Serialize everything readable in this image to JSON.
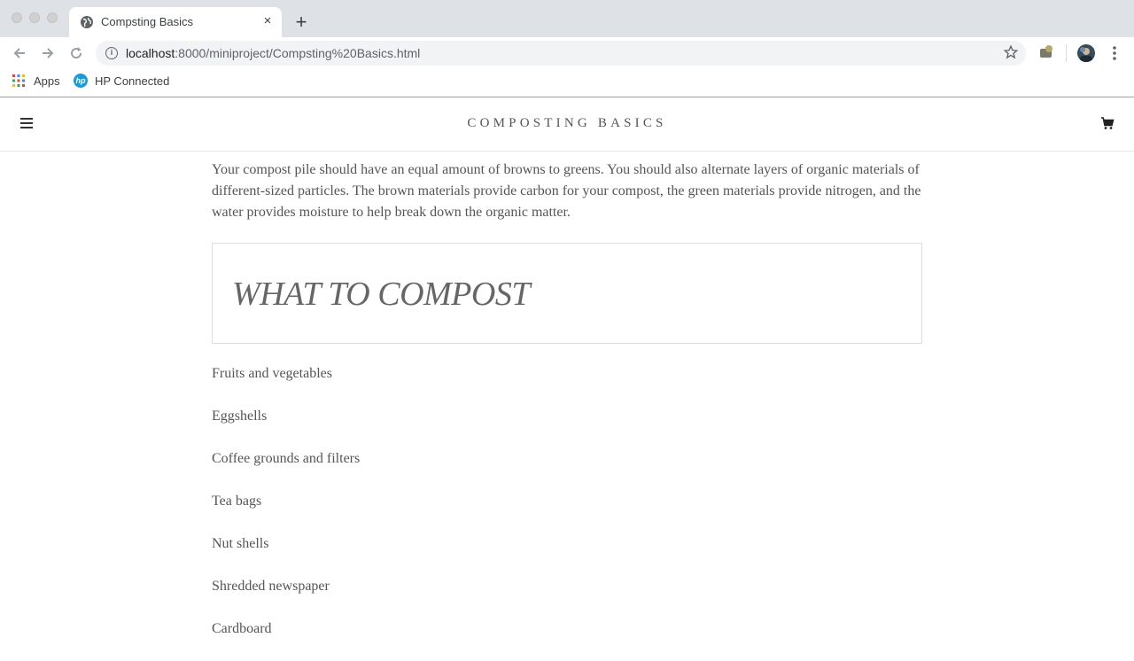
{
  "browser": {
    "tab_title": "Compsting Basics",
    "tab_close": "×",
    "new_tab": "+",
    "url_host": "localhost",
    "url_path": ":8000/miniproject/Compsting%20Basics.html",
    "bookmarks": {
      "apps_label": "Apps",
      "hp_label": "HP Connected"
    },
    "icons": {
      "back": "arrow-left-icon",
      "forward": "arrow-right-icon",
      "reload": "reload-icon",
      "star": "star-icon"
    }
  },
  "site": {
    "title": "COMPOSTING BASICS",
    "intro": "Your compost pile should have an equal amount of browns to greens. You should also alternate layers of organic materials of different-sized particles. The brown materials provide carbon for your compost, the green materials provide nitrogen, and the water provides moisture to help break down the organic matter.",
    "section_title": "WHAT TO COMPOST",
    "items": [
      "Fruits and vegetables",
      "Eggshells",
      "Coffee grounds and filters",
      "Tea bags",
      "Nut shells",
      "Shredded newspaper",
      "Cardboard"
    ]
  },
  "colors": {
    "chrome_bg": "#dee1e6",
    "omnibox_bg": "#f1f3f4",
    "text": "#555555"
  }
}
